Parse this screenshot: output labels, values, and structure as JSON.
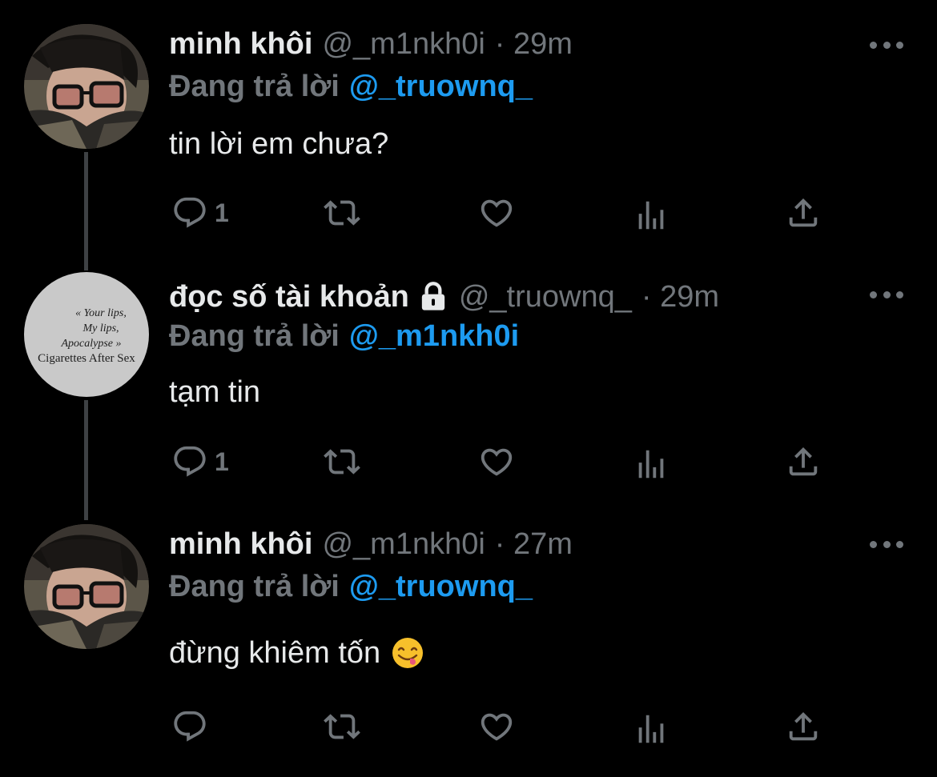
{
  "tweets": [
    {
      "display_name": "minh khôi",
      "handle": "@_m1nkh0i",
      "time": "· 29m",
      "reply_prefix": "Đang trả lời",
      "reply_to": "@_truownq_",
      "text": "tin lời em chưa?",
      "reply_count": "1",
      "avatar": "man-with-glasses-avatar"
    },
    {
      "display_name": "đọc số tài khoản",
      "handle": "@_truownq_",
      "time": "· 29m",
      "reply_prefix": "Đang trả lời",
      "reply_to": "@_m1nkh0i",
      "text": "tạm tin",
      "reply_count": "1",
      "locked": true,
      "avatar_text": [
        "« Your lips,",
        "My lips,",
        "Apocalypse »",
        "Cigarettes After Sex"
      ]
    },
    {
      "display_name": "minh khôi",
      "handle": "@_m1nkh0i",
      "time": "· 27m",
      "reply_prefix": "Đang trả lời",
      "reply_to": "@_truownq_",
      "text": "đừng khiêm tốn",
      "emoji": "face-savoring-food-emoji",
      "reply_count": "",
      "avatar": "man-with-glasses-avatar"
    }
  ],
  "icons": [
    "reply-icon",
    "retweet-icon",
    "like-icon",
    "views-icon",
    "share-icon",
    "more-icon",
    "lock-icon"
  ],
  "colors": {
    "background": "#000000",
    "primary_text": "#e7e9ea",
    "secondary_text": "#71767b",
    "accent": "#1d9bf0",
    "thread_line": "#3e4144"
  }
}
